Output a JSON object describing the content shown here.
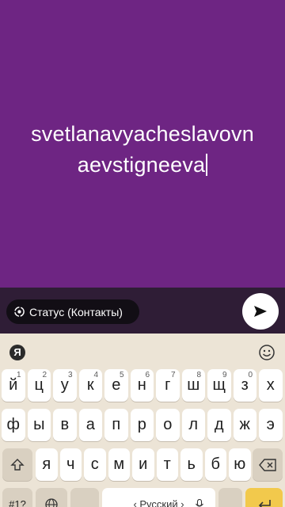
{
  "composer": {
    "text_line1": "svetlanavyacheslavovn",
    "text_line2": "aevstigneeva",
    "background": "#6e2583"
  },
  "action_bar": {
    "privacy_label": "Статус (Контакты)",
    "privacy_icon": "status-ring-icon",
    "send_icon": "send-arrow-icon"
  },
  "keyboard": {
    "logo": "Я",
    "emoji_icon": "smiley-icon",
    "row1": [
      {
        "c": "й",
        "h": "1"
      },
      {
        "c": "ц",
        "h": "2"
      },
      {
        "c": "у",
        "h": "3"
      },
      {
        "c": "к",
        "h": "4"
      },
      {
        "c": "е",
        "h": "5"
      },
      {
        "c": "н",
        "h": "6"
      },
      {
        "c": "г",
        "h": "7"
      },
      {
        "c": "ш",
        "h": "8"
      },
      {
        "c": "щ",
        "h": "9"
      },
      {
        "c": "з",
        "h": "0"
      },
      {
        "c": "х",
        "h": ""
      }
    ],
    "row2": [
      "ф",
      "ы",
      "в",
      "а",
      "п",
      "р",
      "о",
      "л",
      "д",
      "ж",
      "э"
    ],
    "row3": [
      "я",
      "ч",
      "с",
      "м",
      "и",
      "т",
      "ь",
      "б",
      "ю"
    ],
    "symbols_label": "#1?",
    "space_label": "‹ Русский ›",
    "shift_icon": "shift-icon",
    "backspace_icon": "backspace-icon",
    "globe_icon": "globe-icon",
    "mic_icon": "mic-icon",
    "enter_icon": "enter-icon"
  }
}
